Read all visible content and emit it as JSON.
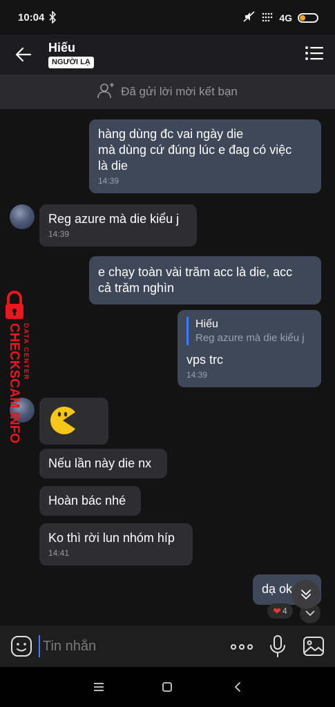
{
  "status_bar": {
    "time": "10:04",
    "network": "4G",
    "battery_level": 0.35,
    "icons": [
      "bluetooth-icon",
      "mute-icon",
      "signal-icon",
      "battery-icon"
    ]
  },
  "header": {
    "name": "Hiếu",
    "badge": "NGƯỜI LẠ"
  },
  "friend_banner": {
    "text": "Đã gửi lời mời kết bạn"
  },
  "messages": [
    {
      "direction": "out",
      "text": "hàng dùng đc vai ngày die\nmà dùng cứ đúng lúc e đag có việc\nlà die",
      "time": "14:39"
    },
    {
      "direction": "in",
      "text": "Reg azure mà die kiểu j",
      "time": "14:39"
    },
    {
      "direction": "out",
      "text": "e chạy toàn vài trăm acc là die, acc\ncả trăm nghìn",
      "time": ""
    },
    {
      "direction": "out",
      "quote": {
        "name": "Hiếu",
        "text": "Reg azure mà die kiểu j"
      },
      "text": "vps trc",
      "time": "14:39"
    },
    {
      "direction": "in",
      "sticker": "pacman-sticker",
      "text": "",
      "time": ""
    },
    {
      "direction": "in",
      "text": "Nếu lần này die nx",
      "time": ""
    },
    {
      "direction": "in",
      "text": "Hoàn bác nhé",
      "time": ""
    },
    {
      "direction": "in",
      "text": "Ko thì rời lun nhóm híp",
      "time": "14:41"
    },
    {
      "direction": "out",
      "text": "dạ ok",
      "time": "",
      "reaction": {
        "emoji": "❤",
        "count": "4"
      }
    }
  ],
  "watermark": {
    "line1": "CHECKSCAM.INFO",
    "line2": "DATA CENTER"
  },
  "input": {
    "placeholder": "Tin nhắn"
  },
  "colors": {
    "outgoing_bubble": "#3e4858",
    "incoming_bubble": "#2e2e30",
    "accent": "#3b7cff",
    "watermark": "#e8181e"
  }
}
